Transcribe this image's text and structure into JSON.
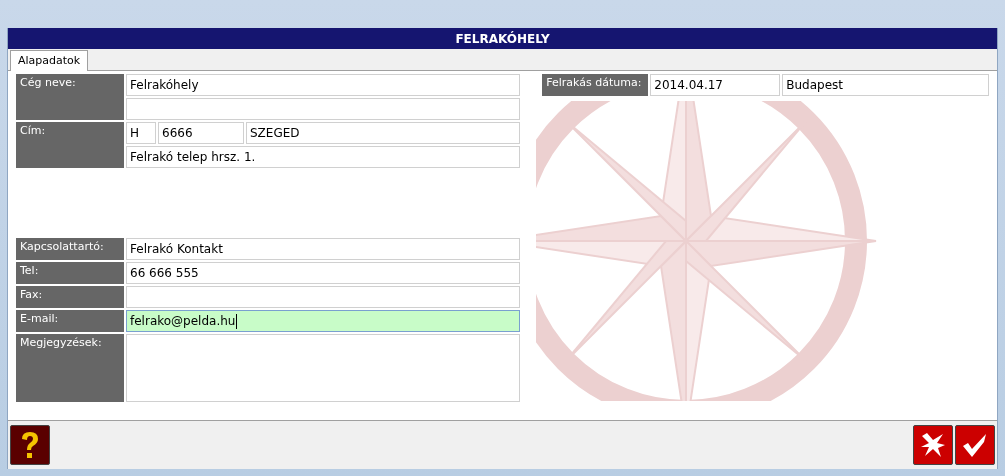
{
  "window": {
    "title": "FELRAKÓHELY"
  },
  "tabs": [
    {
      "label": "Alapadatok",
      "selected": true
    }
  ],
  "left_groups": [
    [
      {
        "label": "Cég neve:",
        "lines": [
          [
            {
              "kind": "input",
              "value": "Felrakóhely",
              "focused": false
            }
          ],
          [
            {
              "kind": "input",
              "focused": false
            }
          ]
        ]
      },
      {
        "label": "Cím:",
        "lines": [
          [
            {
              "kind": "code",
              "value": "H",
              "focused": false
            },
            {
              "kind": "code",
              "value": "6666",
              "focused": false
            },
            {
              "kind": "input",
              "value": "SZEGED",
              "focused": false
            }
          ],
          [
            {
              "kind": "input",
              "value": "Felrakó telep hrsz. 1.",
              "focused": false
            }
          ]
        ]
      }
    ],
    [
      {
        "label": "Kapcsolattartó:",
        "lines": [
          [
            {
              "kind": "input",
              "value": "Felrakó Kontakt",
              "focused": false
            }
          ]
        ]
      },
      {
        "label": "Tel:",
        "lines": [
          [
            {
              "kind": "input",
              "value": "66 666 555",
              "focused": false
            }
          ]
        ]
      },
      {
        "label": "Fax:",
        "lines": [
          [
            {
              "kind": "input",
              "focused": false
            }
          ]
        ]
      },
      {
        "label": "E-mail:",
        "lines": [
          [
            {
              "kind": "input",
              "value": "felrako@pelda.hu",
              "focused": true
            }
          ]
        ]
      },
      {
        "label": "Megjegyzések:",
        "lines": [
          [
            {
              "kind": "textarea",
              "focused": false
            }
          ]
        ]
      }
    ]
  ],
  "right_fields": [
    {
      "label": "Felrakás dátuma:",
      "lines": [
        [
          {
            "kind": "code",
            "value": "2014.04.17",
            "focused": false
          },
          {
            "kind": "input",
            "value": "Budapest",
            "focused": false
          }
        ]
      ]
    }
  ],
  "buttons": [
    {
      "kind": "help"
    },
    {
      "kind": "cancel"
    },
    {
      "kind": "ok"
    }
  ]
}
